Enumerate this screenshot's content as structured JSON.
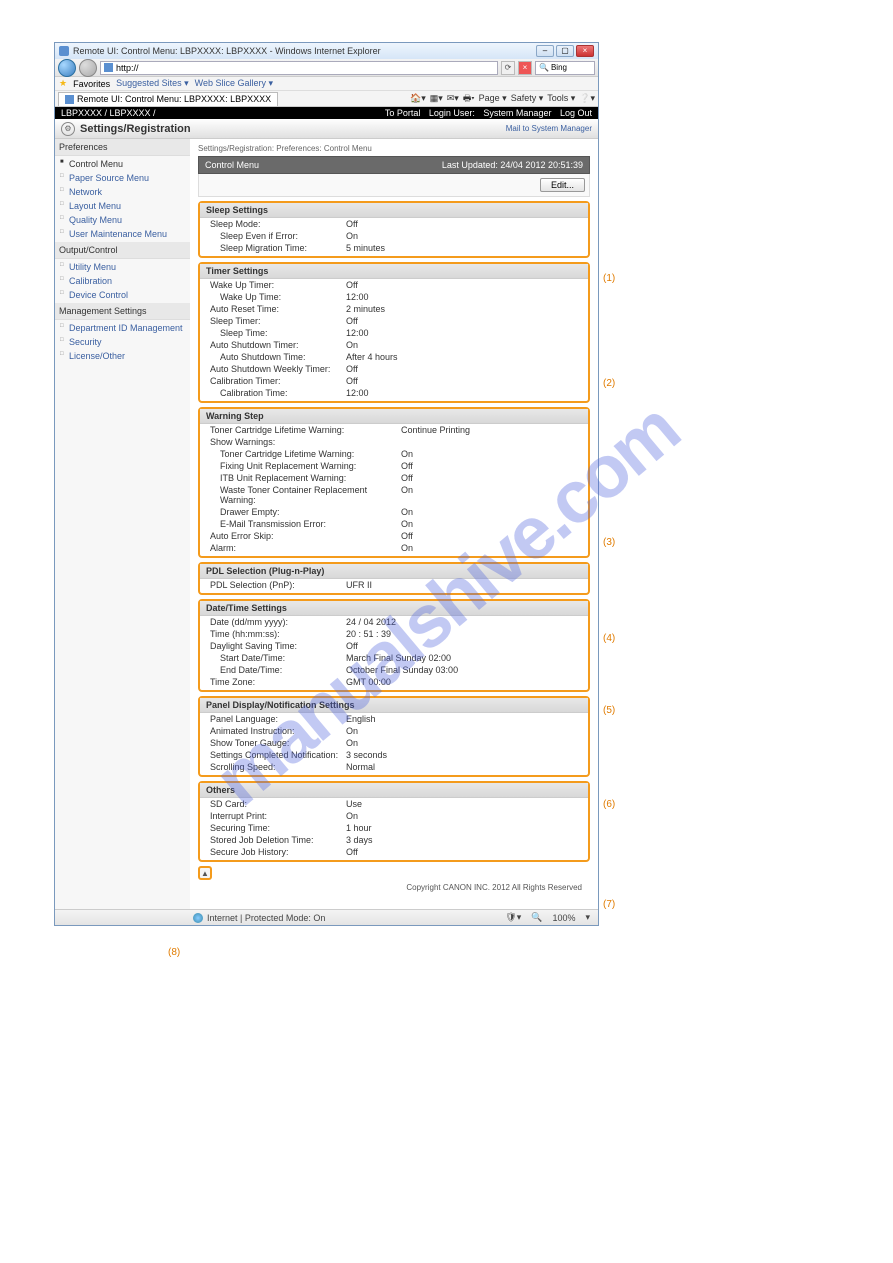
{
  "watermark": "manualshive.com",
  "window": {
    "title": "Remote UI: Control Menu: LBPXXXX: LBPXXXX - Windows Internet Explorer",
    "nav_url": "http://",
    "search_engine": "Bing",
    "fav_label": "Favorites",
    "fav_links": [
      "Suggested Sites ▾",
      "Web Slice Gallery ▾"
    ],
    "tab": "Remote UI: Control Menu: LBPXXXX: LBPXXXX",
    "toolbar": [
      "Page ▾",
      "Safety ▾",
      "Tools ▾"
    ],
    "status_mode": "Internet | Protected Mode: On",
    "zoom": "100%"
  },
  "topbar": {
    "left": "LBPXXXX / LBPXXXX /",
    "links": {
      "portal": "To Portal",
      "login": "Login User:",
      "user": "System Manager",
      "logout": "Log Out"
    }
  },
  "header": {
    "title": "Settings/Registration",
    "right": "Mail to System Manager"
  },
  "sidebar": {
    "sections": [
      {
        "title": "Preferences",
        "items": [
          {
            "label": "Control Menu",
            "selected": true
          },
          {
            "label": "Paper Source Menu"
          },
          {
            "label": "Network"
          },
          {
            "label": "Layout Menu"
          },
          {
            "label": "Quality Menu"
          },
          {
            "label": "User Maintenance Menu"
          }
        ]
      },
      {
        "title": "Output/Control",
        "items": [
          {
            "label": "Utility Menu"
          },
          {
            "label": "Calibration"
          },
          {
            "label": "Device Control"
          }
        ]
      },
      {
        "title": "Management Settings",
        "items": [
          {
            "label": "Department ID Management"
          },
          {
            "label": "Security"
          },
          {
            "label": "License/Other"
          }
        ]
      }
    ]
  },
  "crumb": "Settings/Registration: Preferences: Control Menu",
  "band": {
    "title": "Control Menu",
    "right": "Last Updated: 24/04 2012 20:51:39"
  },
  "edit_btn": "Edit...",
  "groups": [
    {
      "callout": "(1)",
      "title": "Sleep Settings",
      "rows": [
        {
          "k": "Sleep Mode:",
          "v": "Off"
        },
        {
          "k": "Sleep Even if Error:",
          "v": "On",
          "indent": 1
        },
        {
          "k": "Sleep Migration Time:",
          "v": "5 minutes",
          "indent": 1
        }
      ]
    },
    {
      "callout": "(2)",
      "title": "Timer Settings",
      "rows": [
        {
          "k": "Wake Up Timer:",
          "v": "Off"
        },
        {
          "k": "Wake Up Time:",
          "v": "12:00",
          "indent": 1
        },
        {
          "k": "Auto Reset Time:",
          "v": "2 minutes"
        },
        {
          "k": "Sleep Timer:",
          "v": "Off"
        },
        {
          "k": "Sleep Time:",
          "v": "12:00",
          "indent": 1
        },
        {
          "k": "Auto Shutdown Timer:",
          "v": "On"
        },
        {
          "k": "Auto Shutdown Time:",
          "v": "After 4 hours",
          "indent": 1
        },
        {
          "k": "Auto Shutdown Weekly Timer:",
          "v": "Off"
        },
        {
          "k": "Calibration Timer:",
          "v": "Off"
        },
        {
          "k": "Calibration Time:",
          "v": "12:00",
          "indent": 1
        }
      ]
    },
    {
      "callout": "(3)",
      "title": "Warning Step",
      "wide": true,
      "rows": [
        {
          "k": "Toner Cartridge Lifetime Warning:",
          "v": "Continue Printing"
        },
        {
          "k": "Show Warnings:",
          "v": ""
        },
        {
          "k": "Toner Cartridge Lifetime Warning:",
          "v": "On",
          "indent": 1
        },
        {
          "k": "Fixing Unit Replacement Warning:",
          "v": "Off",
          "indent": 1
        },
        {
          "k": "ITB Unit Replacement Warning:",
          "v": "Off",
          "indent": 1
        },
        {
          "k": "Waste Toner Container Replacement Warning:",
          "v": "On",
          "indent": 1
        },
        {
          "k": "Drawer Empty:",
          "v": "On",
          "indent": 1
        },
        {
          "k": "E-Mail Transmission Error:",
          "v": "On",
          "indent": 1
        },
        {
          "k": "Auto Error Skip:",
          "v": "Off"
        },
        {
          "k": "Alarm:",
          "v": "On"
        }
      ]
    },
    {
      "callout": "(4)",
      "title": "PDL Selection (Plug-n-Play)",
      "rows": [
        {
          "k": "PDL Selection (PnP):",
          "v": "UFR II"
        }
      ]
    },
    {
      "callout": "(5)",
      "title": "Date/Time Settings",
      "rows": [
        {
          "k": "Date (dd/mm yyyy):",
          "v": "24 / 04 2012"
        },
        {
          "k": "Time (hh:mm:ss):",
          "v": "20 : 51 : 39"
        },
        {
          "k": "Daylight Saving Time:",
          "v": "Off"
        },
        {
          "k": "Start Date/Time:",
          "v": "March Final Sunday 02:00",
          "indent": 1
        },
        {
          "k": "End Date/Time:",
          "v": "October Final Sunday 03:00",
          "indent": 1
        },
        {
          "k": "Time Zone:",
          "v": "GMT 00:00"
        }
      ]
    },
    {
      "callout": "(6)",
      "title": "Panel Display/Notification Settings",
      "rows": [
        {
          "k": "Panel Language:",
          "v": "English"
        },
        {
          "k": "Animated Instruction:",
          "v": "On"
        },
        {
          "k": "Show Toner Gauge:",
          "v": "On"
        },
        {
          "k": "Settings Completed Notification:",
          "v": "3 seconds"
        },
        {
          "k": "Scrolling Speed:",
          "v": "Normal"
        }
      ]
    },
    {
      "callout": "(7)",
      "title": "Others",
      "rows": [
        {
          "k": "SD Card:",
          "v": "Use"
        },
        {
          "k": "Interrupt Print:",
          "v": "On"
        },
        {
          "k": "Securing Time:",
          "v": "1 hour"
        },
        {
          "k": "Stored Job Deletion Time:",
          "v": "3 days"
        },
        {
          "k": "Secure Job History:",
          "v": "Off"
        }
      ]
    }
  ],
  "callout8": "(8)",
  "copyright": "Copyright CANON INC. 2012 All Rights Reserved"
}
